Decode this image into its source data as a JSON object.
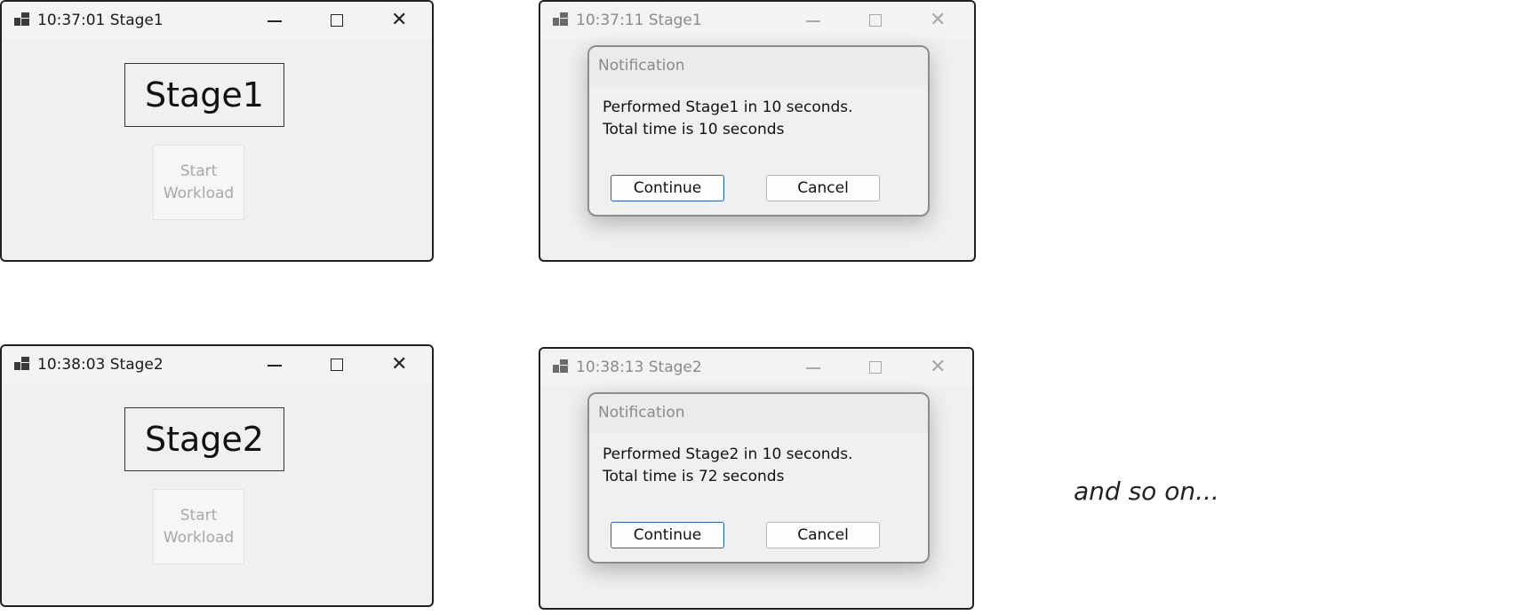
{
  "windows": [
    {
      "title": "10:37:01 Stage1",
      "stage_label": "Stage1",
      "start_button": {
        "line1": "Start",
        "line2": "Workload"
      }
    },
    {
      "title": "10:37:11 Stage1",
      "dialog": {
        "title": "Notification",
        "line1": "Performed Stage1 in 10 seconds.",
        "line2": "Total time is 10 seconds",
        "continue_label": "Continue",
        "cancel_label": "Cancel"
      }
    },
    {
      "title": "10:38:03 Stage2",
      "stage_label": "Stage2",
      "start_button": {
        "line1": "Start",
        "line2": "Workload"
      }
    },
    {
      "title": "10:38:13 Stage2",
      "dialog": {
        "title": "Notification",
        "line1": "Performed Stage2 in 10 seconds.",
        "line2": "Total time is 72 seconds",
        "continue_label": "Continue",
        "cancel_label": "Cancel"
      }
    }
  ],
  "footer_text": "and so on...",
  "icons": {
    "app": "app-windows-icon",
    "minimize": "minimize-icon",
    "maximize": "maximize-icon",
    "close": "close-icon"
  },
  "colors": {
    "window_bg": "#f0f0f0",
    "window_border": "#202020",
    "accent_border": "#1f65b0",
    "disabled_text": "#a8a8a8"
  }
}
